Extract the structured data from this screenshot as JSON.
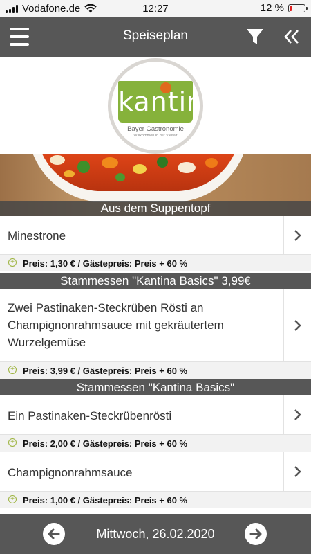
{
  "status_bar": {
    "carrier": "Vodafone.de",
    "time": "12:27",
    "battery_text": "12 %",
    "battery_level": 0.12
  },
  "header": {
    "title": "Speiseplan",
    "icons": [
      "menu-icon",
      "filter-icon",
      "double-chevron-left-icon"
    ]
  },
  "logo": {
    "wordmark": "kantina",
    "subtitle": "Bayer Gastronomie",
    "tagline": "Willkommen in der Vielfalt"
  },
  "banner": {
    "section_title": "Aus dem Suppentopf"
  },
  "items": [
    {
      "name": "Minestrone",
      "price": "Preis: 1,30 € / Gästepreis: Preis + 60 %"
    },
    {
      "name": "Zwei Pastinaken-Steckrüben Rösti an Champignonrahmsauce mit gekräutertem Wurzelgemüse",
      "price": "Preis: 3,99 € / Gästepreis: Preis + 60 %"
    },
    {
      "name": "Ein Pastinaken-Steckrübenrösti",
      "price": "Preis: 2,00 € / Gästepreis: Preis + 60 %"
    },
    {
      "name": "Champignonrahmsauce",
      "price": "Preis: 1,00 € / Gästepreis: Preis + 60 %"
    }
  ],
  "groups": [
    "Stammessen \"Kantina Basics\" 3,99€",
    "Stammessen \"Kantina Basics\""
  ],
  "footer": {
    "date": "Mittwoch, 26.02.2020",
    "icons": [
      "arrow-left-icon",
      "arrow-right-icon"
    ]
  },
  "colors": {
    "bar_gray": "#575757",
    "brand_green": "#86b23b",
    "brand_orange": "#e06a1c",
    "battery_red": "#e02020"
  }
}
